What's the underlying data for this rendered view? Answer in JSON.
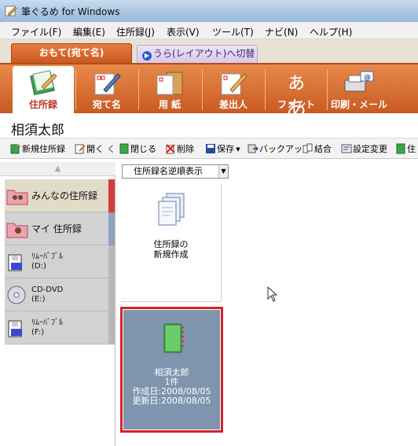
{
  "window": {
    "title": "筆ぐるめ for Windows"
  },
  "menu": [
    "ファイル(F)",
    "編集(E)",
    "住所録(J)",
    "表示(V)",
    "ツール(T)",
    "ナビ(N)",
    "ヘルプ(H)"
  ],
  "tabs": {
    "front": "おもて(宛て名)",
    "back": "うら(レイアウト)へ切替"
  },
  "ribbon": [
    "住所録",
    "宛て名",
    "用 紙",
    "差出人",
    "フォント",
    "印刷・メール"
  ],
  "page_title": "相須太郎",
  "toolbar": [
    "新規住所録",
    "開く",
    "閉じる",
    "削除",
    "保存",
    "バックアップ",
    "結合",
    "設定変更",
    "住"
  ],
  "sidebar": {
    "items": [
      {
        "label": "みんなの住所録"
      },
      {
        "label": "マイ 住所録"
      },
      {
        "label1": "ﾘﾑｰﾊﾞﾌﾞﾙ",
        "label2": "(D:)"
      },
      {
        "label1": "CD-DVD",
        "label2": "(E:)"
      },
      {
        "label1": "ﾘﾑｰﾊﾞﾌﾞﾙ",
        "label2": "(F:)"
      }
    ]
  },
  "main": {
    "sort": "住所録名逆順表示",
    "new_card": {
      "line1": "住所録の",
      "line2": "新規作成"
    },
    "book": {
      "name": "相須太郎",
      "count": "1件",
      "created": "作成日:2008/08/05",
      "updated": "更新日:2008/08/05"
    }
  },
  "colors": {
    "accent": "#c85a22",
    "selected_border": "#d3232a",
    "card_bg": "#7f94ad"
  }
}
